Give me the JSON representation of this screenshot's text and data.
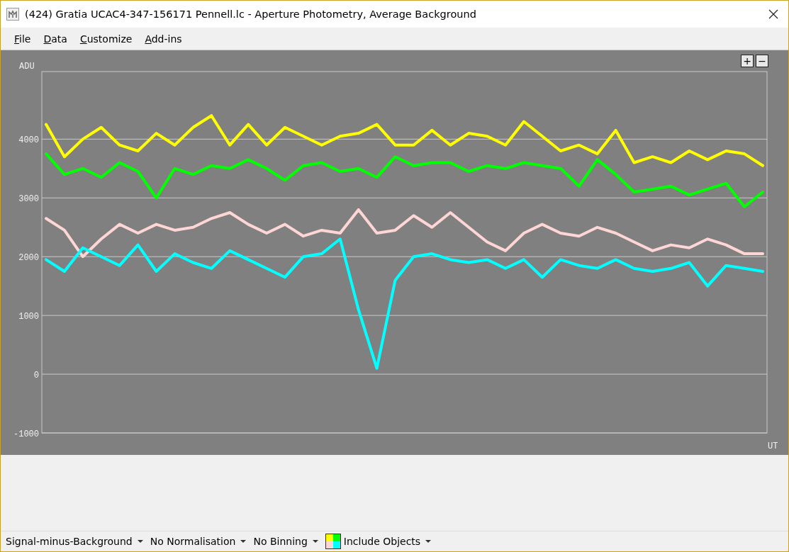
{
  "window": {
    "title": "(424) Gratia UCAC4-347-156171 Pennell.lc - Aperture Photometry, Average Background"
  },
  "menu": [
    {
      "label": "File"
    },
    {
      "label": "Data"
    },
    {
      "label": "Customize"
    },
    {
      "label": "Add-ins"
    }
  ],
  "zoom_buttons": [
    "+",
    "−"
  ],
  "chart": {
    "chart_data": {
      "type": "line",
      "ylabel": "ADU",
      "xlabel": "UT",
      "ylim": [
        -1000,
        5150
      ],
      "yticks": [
        -1000,
        0,
        1000,
        2000,
        3000,
        4000
      ],
      "grid": true,
      "series": [
        {
          "color": "#ffff00",
          "values": [
            4250,
            3700,
            4000,
            4200,
            3900,
            3800,
            4100,
            3900,
            4200,
            4400,
            3900,
            4250,
            3900,
            4200,
            4050,
            3900,
            4050,
            4100,
            4250,
            3900,
            3900,
            4150,
            3900,
            4100,
            4050,
            3900,
            4300,
            4050,
            3800,
            3900,
            3750,
            4150,
            3600,
            3700,
            3600,
            3800,
            3650,
            3800,
            3750,
            3550
          ]
        },
        {
          "color": "#00ff00",
          "values": [
            3750,
            3400,
            3500,
            3350,
            3600,
            3450,
            3000,
            3500,
            3400,
            3550,
            3500,
            3650,
            3500,
            3300,
            3550,
            3600,
            3450,
            3500,
            3350,
            3700,
            3550,
            3600,
            3600,
            3450,
            3550,
            3500,
            3600,
            3550,
            3500,
            3200,
            3650,
            3400,
            3100,
            3150,
            3200,
            3050,
            3150,
            3250,
            2850,
            3100
          ]
        },
        {
          "color": "#ffd6d6",
          "values": [
            2650,
            2450,
            2000,
            2300,
            2550,
            2400,
            2550,
            2450,
            2500,
            2650,
            2750,
            2550,
            2400,
            2550,
            2350,
            2450,
            2400,
            2800,
            2400,
            2450,
            2700,
            2500,
            2750,
            2500,
            2250,
            2100,
            2400,
            2550,
            2400,
            2350,
            2500,
            2400,
            2250,
            2100,
            2200,
            2150,
            2300,
            2200,
            2050,
            2050
          ]
        },
        {
          "color": "#00ffff",
          "values": [
            1950,
            1750,
            2150,
            2000,
            1850,
            2200,
            1750,
            2050,
            1900,
            1800,
            2100,
            1950,
            1800,
            1650,
            2000,
            2050,
            2300,
            1100,
            100,
            1600,
            2000,
            2050,
            1950,
            1900,
            1950,
            1800,
            1950,
            1650,
            1950,
            1850,
            1800,
            1950,
            1800,
            1750,
            1800,
            1900,
            1500,
            1850,
            1800,
            1750
          ]
        }
      ]
    }
  },
  "status_bar": [
    {
      "label": "Signal-minus-Background",
      "kind": "dropdown"
    },
    {
      "label": "No Normalisation",
      "kind": "dropdown"
    },
    {
      "label": "No Binning",
      "kind": "dropdown"
    },
    {
      "label": "Include Objects",
      "kind": "legend-dropdown"
    }
  ]
}
